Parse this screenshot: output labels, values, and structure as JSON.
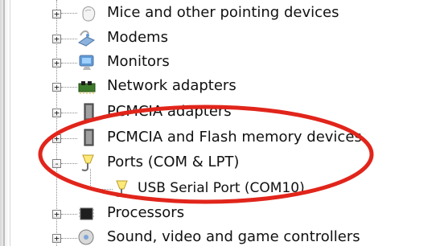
{
  "device_tree": {
    "items": [
      {
        "label": "Mice and other pointing devices",
        "icon": "mouse-icon",
        "expander": "+"
      },
      {
        "label": "Modems",
        "icon": "modem-icon",
        "expander": "+"
      },
      {
        "label": "Monitors",
        "icon": "monitor-icon",
        "expander": "+"
      },
      {
        "label": "Network adapters",
        "icon": "network-adapter-icon",
        "expander": "+"
      },
      {
        "label": "PCMCIA adapters",
        "icon": "pcmcia-adapter-icon",
        "expander": "+"
      },
      {
        "label": "PCMCIA and Flash memory devices",
        "icon": "flash-memory-icon",
        "expander": "+"
      },
      {
        "label": "Ports (COM & LPT)",
        "icon": "port-icon",
        "expander": "-"
      },
      {
        "label": "USB Serial Port (COM10)",
        "icon": "usb-serial-port-icon"
      },
      {
        "label": "Processors",
        "icon": "processor-icon",
        "expander": "+"
      },
      {
        "label": "Sound, video and game controllers",
        "icon": "sound-video-icon",
        "expander": "+"
      }
    ]
  },
  "annotation": {
    "color": "#e1251b"
  }
}
